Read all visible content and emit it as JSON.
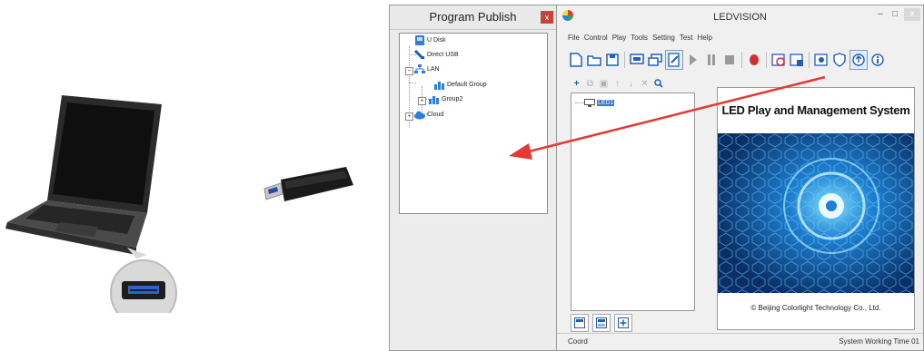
{
  "program_publish": {
    "title": "Program Publish",
    "close_label": "x",
    "tree": {
      "u_disk": "U Disk",
      "direct_usb": "Direct USB",
      "lan": "LAN",
      "default_group": "Default Group",
      "group2": "Group2",
      "cloud": "Cloud"
    }
  },
  "ledvision": {
    "title": "LEDVISION",
    "minimize_label": "–",
    "maximize_label": "□",
    "close_label": "x",
    "menu": [
      "File",
      "Control",
      "Play",
      "Tools",
      "Setting",
      "Test",
      "Help"
    ],
    "screen_item": "LED1",
    "preview_heading": "LED Play and Management System",
    "preview_copyright": "© Beijing Colorlight Technology Co., Ltd.",
    "status_left": "Coord",
    "status_right": "System Working Time 01"
  },
  "colors": {
    "arrow": "#e53935",
    "selection": "#3875d7",
    "preview_bg": "#0a3b7a"
  }
}
